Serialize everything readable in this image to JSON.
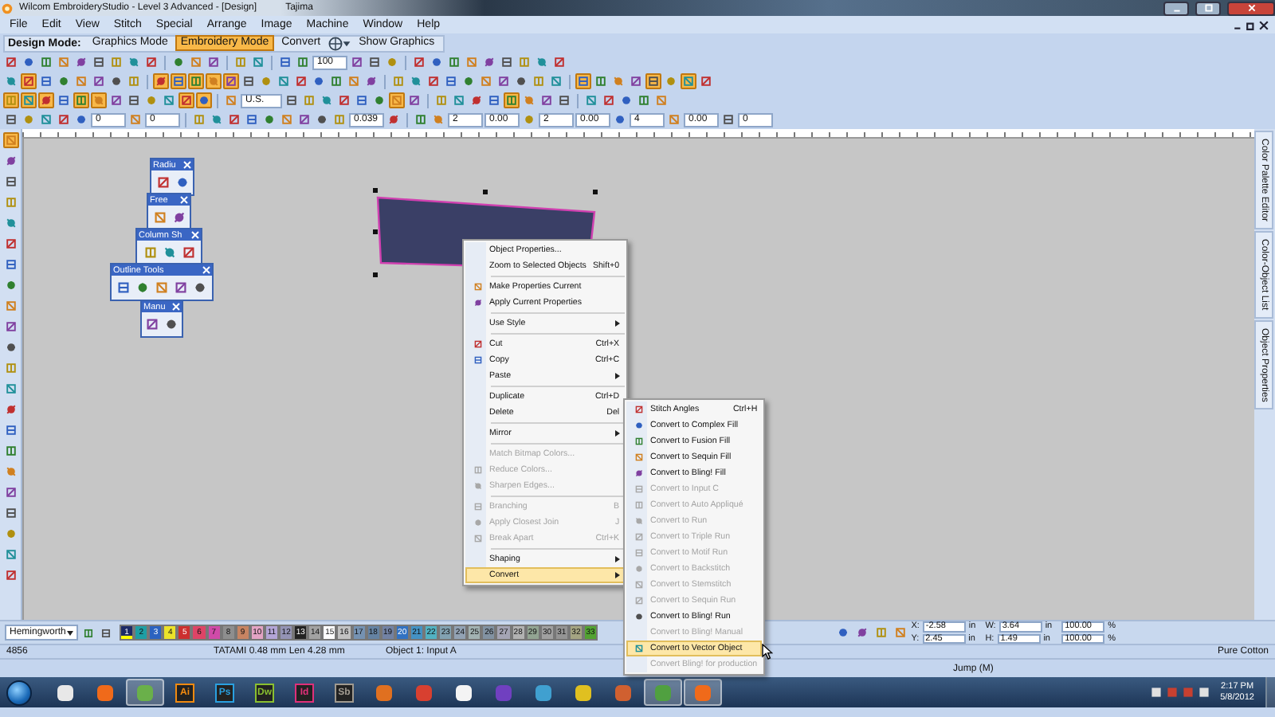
{
  "window": {
    "title": "Wilcom EmbroideryStudio - Level 3 Advanced - [Design]",
    "machine": "Tajima"
  },
  "menu_bar": [
    "File",
    "Edit",
    "View",
    "Stitch",
    "Special",
    "Arrange",
    "Image",
    "Machine",
    "Window",
    "Help"
  ],
  "mode_bar": {
    "label": "Design Mode:",
    "modes": [
      {
        "label": "Graphics Mode",
        "selected": false
      },
      {
        "label": "Embroidery Mode",
        "selected": true
      }
    ],
    "convert": "Convert",
    "show_graphics": "Show Graphics"
  },
  "toolbars": [
    {
      "items": [
        {
          "kind": "icon",
          "pressed": false
        },
        {
          "kind": "icon",
          "pressed": false
        },
        {
          "kind": "icon",
          "pressed": false
        },
        {
          "kind": "icon",
          "pressed": false
        },
        {
          "kind": "icon",
          "pressed": false
        },
        {
          "kind": "icon",
          "pressed": false
        },
        {
          "kind": "icon",
          "pressed": false
        },
        {
          "kind": "icon",
          "pressed": false
        },
        {
          "kind": "icon",
          "pressed": false
        },
        {
          "kind": "sep"
        },
        {
          "kind": "icon",
          "pressed": false
        },
        {
          "kind": "icon",
          "pressed": false
        },
        {
          "kind": "icon",
          "pressed": false
        },
        {
          "kind": "sep"
        },
        {
          "kind": "icon",
          "pressed": false
        },
        {
          "kind": "icon",
          "pressed": false
        },
        {
          "kind": "sep"
        },
        {
          "kind": "icon",
          "pressed": false
        },
        {
          "kind": "icon",
          "pressed": false
        },
        {
          "kind": "field",
          "value": "100"
        },
        {
          "kind": "icon",
          "pressed": false
        },
        {
          "kind": "icon",
          "pressed": false
        },
        {
          "kind": "icon",
          "pressed": false
        },
        {
          "kind": "sep"
        },
        {
          "kind": "icon",
          "pressed": false
        },
        {
          "kind": "icon",
          "pressed": false
        },
        {
          "kind": "icon",
          "pressed": false
        },
        {
          "kind": "icon",
          "pressed": false
        },
        {
          "kind": "icon",
          "pressed": false
        },
        {
          "kind": "icon",
          "pressed": false
        },
        {
          "kind": "icon",
          "pressed": false
        },
        {
          "kind": "icon",
          "pressed": false
        },
        {
          "kind": "icon",
          "pressed": false
        }
      ]
    },
    {
      "items": [
        {
          "kind": "icon",
          "pressed": false
        },
        {
          "kind": "icon",
          "pressed": true
        },
        {
          "kind": "icon",
          "pressed": false
        },
        {
          "kind": "icon",
          "pressed": false
        },
        {
          "kind": "icon",
          "pressed": false
        },
        {
          "kind": "icon",
          "pressed": false
        },
        {
          "kind": "icon",
          "pressed": false
        },
        {
          "kind": "icon",
          "pressed": false
        },
        {
          "kind": "sep"
        },
        {
          "kind": "icon",
          "pressed": true
        },
        {
          "kind": "icon",
          "pressed": true
        },
        {
          "kind": "icon",
          "pressed": true
        },
        {
          "kind": "icon",
          "pressed": true
        },
        {
          "kind": "icon",
          "pressed": true
        },
        {
          "kind": "icon",
          "pressed": false
        },
        {
          "kind": "icon",
          "pressed": false
        },
        {
          "kind": "icon",
          "pressed": false
        },
        {
          "kind": "icon",
          "pressed": false
        },
        {
          "kind": "icon",
          "pressed": false
        },
        {
          "kind": "icon",
          "pressed": false
        },
        {
          "kind": "icon",
          "pressed": false
        },
        {
          "kind": "icon",
          "pressed": false
        },
        {
          "kind": "sep"
        },
        {
          "kind": "icon",
          "pressed": false
        },
        {
          "kind": "icon",
          "pressed": false
        },
        {
          "kind": "icon",
          "pressed": false
        },
        {
          "kind": "icon",
          "pressed": false
        },
        {
          "kind": "icon",
          "pressed": false
        },
        {
          "kind": "icon",
          "pressed": false
        },
        {
          "kind": "icon",
          "pressed": false
        },
        {
          "kind": "icon",
          "pressed": false
        },
        {
          "kind": "icon",
          "pressed": false
        },
        {
          "kind": "icon",
          "pressed": false
        },
        {
          "kind": "sep"
        },
        {
          "kind": "icon",
          "pressed": true
        },
        {
          "kind": "icon",
          "pressed": false
        },
        {
          "kind": "icon",
          "pressed": false
        },
        {
          "kind": "icon",
          "pressed": false
        },
        {
          "kind": "icon",
          "pressed": true
        },
        {
          "kind": "icon",
          "pressed": false
        },
        {
          "kind": "icon",
          "pressed": true
        },
        {
          "kind": "icon",
          "pressed": false
        }
      ]
    },
    {
      "items": [
        {
          "kind": "icon",
          "pressed": true
        },
        {
          "kind": "icon",
          "pressed": true
        },
        {
          "kind": "icon",
          "pressed": true
        },
        {
          "kind": "icon",
          "pressed": false
        },
        {
          "kind": "icon",
          "pressed": true
        },
        {
          "kind": "icon",
          "pressed": true
        },
        {
          "kind": "icon",
          "pressed": false
        },
        {
          "kind": "icon",
          "pressed": false
        },
        {
          "kind": "icon",
          "pressed": false
        },
        {
          "kind": "icon",
          "pressed": false
        },
        {
          "kind": "icon",
          "pressed": true
        },
        {
          "kind": "icon",
          "pressed": true
        },
        {
          "kind": "sep"
        },
        {
          "kind": "icon",
          "pressed": false
        },
        {
          "kind": "dropdown",
          "value": "U.S."
        },
        {
          "kind": "icon",
          "pressed": false
        },
        {
          "kind": "icon",
          "pressed": false
        },
        {
          "kind": "icon",
          "pressed": false
        },
        {
          "kind": "icon",
          "pressed": false
        },
        {
          "kind": "icon",
          "pressed": false
        },
        {
          "kind": "icon",
          "pressed": false
        },
        {
          "kind": "icon",
          "pressed": true
        },
        {
          "kind": "icon",
          "pressed": false
        },
        {
          "kind": "sep"
        },
        {
          "kind": "icon",
          "pressed": false
        },
        {
          "kind": "icon",
          "pressed": false
        },
        {
          "kind": "icon",
          "pressed": false
        },
        {
          "kind": "icon",
          "pressed": false
        },
        {
          "kind": "icon",
          "pressed": true
        },
        {
          "kind": "icon",
          "pressed": false
        },
        {
          "kind": "icon",
          "pressed": false
        },
        {
          "kind": "icon",
          "pressed": false
        },
        {
          "kind": "sep"
        },
        {
          "kind": "icon",
          "pressed": false
        },
        {
          "kind": "icon",
          "pressed": false
        },
        {
          "kind": "icon",
          "pressed": false
        },
        {
          "kind": "icon",
          "pressed": false
        },
        {
          "kind": "icon",
          "pressed": false
        }
      ]
    },
    {
      "items": [
        {
          "kind": "icon",
          "pressed": false
        },
        {
          "kind": "icon",
          "pressed": false
        },
        {
          "kind": "icon",
          "pressed": false
        },
        {
          "kind": "icon",
          "pressed": false
        },
        {
          "kind": "icon",
          "pressed": false
        },
        {
          "kind": "field",
          "value": "0"
        },
        {
          "kind": "icon",
          "pressed": false
        },
        {
          "kind": "field",
          "value": "0"
        },
        {
          "kind": "sep"
        },
        {
          "kind": "icon",
          "pressed": false
        },
        {
          "kind": "icon",
          "pressed": false
        },
        {
          "kind": "icon",
          "pressed": false
        },
        {
          "kind": "icon",
          "pressed": false
        },
        {
          "kind": "icon",
          "pressed": false
        },
        {
          "kind": "icon",
          "pressed": false
        },
        {
          "kind": "icon",
          "pressed": false
        },
        {
          "kind": "icon",
          "pressed": false
        },
        {
          "kind": "icon",
          "pressed": false
        },
        {
          "kind": "field",
          "value": "0.039"
        },
        {
          "kind": "icon",
          "pressed": false
        },
        {
          "kind": "sep"
        },
        {
          "kind": "icon",
          "pressed": false
        },
        {
          "kind": "icon",
          "pressed": false
        },
        {
          "kind": "field",
          "value": "2"
        },
        {
          "kind": "field",
          "value": "0.00"
        },
        {
          "kind": "icon",
          "pressed": false
        },
        {
          "kind": "field",
          "value": "2"
        },
        {
          "kind": "field",
          "value": "0.00"
        },
        {
          "kind": "icon",
          "pressed": false
        },
        {
          "kind": "field",
          "value": "4"
        },
        {
          "kind": "icon",
          "pressed": false
        },
        {
          "kind": "field",
          "value": "0.00"
        },
        {
          "kind": "icon",
          "pressed": false
        },
        {
          "kind": "field",
          "value": "0"
        }
      ]
    }
  ],
  "toolbox": [
    {
      "pressed": true
    },
    {
      "pressed": false
    },
    {
      "pressed": false
    },
    {
      "pressed": false
    },
    {
      "pressed": false
    },
    {
      "pressed": false
    },
    {
      "pressed": false
    },
    {
      "pressed": false
    },
    {
      "pressed": false
    },
    {
      "pressed": false
    },
    {
      "pressed": false
    },
    {
      "pressed": false
    },
    {
      "pressed": false
    },
    {
      "pressed": false
    },
    {
      "pressed": false
    },
    {
      "pressed": false
    },
    {
      "pressed": false
    },
    {
      "pressed": false
    },
    {
      "pressed": false
    },
    {
      "pressed": false
    },
    {
      "pressed": false
    },
    {
      "pressed": false
    }
  ],
  "palettes": [
    {
      "title": "Radiu",
      "buttons": [
        {
          "pressed": false
        },
        {
          "pressed": false
        }
      ]
    },
    {
      "title": "Free",
      "buttons": [
        {
          "pressed": false
        },
        {
          "pressed": false
        }
      ]
    },
    {
      "title": "Column Sh",
      "buttons": [
        {
          "pressed": false
        },
        {
          "pressed": false
        },
        {
          "pressed": false
        }
      ]
    },
    {
      "title": "Outline Tools",
      "buttons": [
        {
          "pressed": false
        },
        {
          "pressed": false
        },
        {
          "pressed": false
        },
        {
          "pressed": false
        },
        {
          "pressed": false
        }
      ]
    },
    {
      "title": "Manu",
      "buttons": [
        {
          "pressed": false
        },
        {
          "pressed": false
        }
      ]
    }
  ],
  "side_tabs": [
    "Color Palette Editor",
    "Color-Object List",
    "Object Properties"
  ],
  "context_menu": {
    "items": [
      {
        "kind": "item",
        "label": "Object Properties...",
        "disabled": false,
        "selected": false,
        "icon": false
      },
      {
        "kind": "item",
        "label": "Zoom to Selected Objects",
        "shortcut": "Shift+0",
        "disabled": false,
        "selected": false,
        "icon": false
      },
      {
        "kind": "separator"
      },
      {
        "kind": "item",
        "label": "Make Properties Current",
        "disabled": false,
        "selected": false,
        "icon": true
      },
      {
        "kind": "item",
        "label": "Apply Current Properties",
        "disabled": false,
        "selected": false,
        "icon": true
      },
      {
        "kind": "separator"
      },
      {
        "kind": "item",
        "label": "Use Style",
        "submenu": true,
        "disabled": false,
        "selected": false,
        "icon": false
      },
      {
        "kind": "separator"
      },
      {
        "kind": "item",
        "label": "Cut",
        "shortcut": "Ctrl+X",
        "disabled": false,
        "selected": false,
        "icon": true
      },
      {
        "kind": "item",
        "label": "Copy",
        "shortcut": "Ctrl+C",
        "disabled": false,
        "selected": false,
        "icon": true
      },
      {
        "kind": "item",
        "label": "Paste",
        "submenu": true,
        "disabled": false,
        "selected": false,
        "icon": false
      },
      {
        "kind": "separator"
      },
      {
        "kind": "item",
        "label": "Duplicate",
        "shortcut": "Ctrl+D",
        "disabled": false,
        "selected": false,
        "icon": false
      },
      {
        "kind": "item",
        "label": "Delete",
        "shortcut": "Del",
        "disabled": false,
        "selected": false,
        "icon": false
      },
      {
        "kind": "separator"
      },
      {
        "kind": "item",
        "label": "Mirror",
        "submenu": true,
        "disabled": false,
        "selected": false,
        "icon": false
      },
      {
        "kind": "separator"
      },
      {
        "kind": "item",
        "label": "Match Bitmap Colors...",
        "disabled": true,
        "selected": false,
        "icon": false
      },
      {
        "kind": "item",
        "label": "Reduce Colors...",
        "disabled": true,
        "selected": false,
        "icon": true
      },
      {
        "kind": "item",
        "label": "Sharpen Edges...",
        "disabled": true,
        "selected": false,
        "icon": true
      },
      {
        "kind": "separator"
      },
      {
        "kind": "item",
        "label": "Branching",
        "shortcut": "B",
        "disabled": true,
        "selected": false,
        "icon": true
      },
      {
        "kind": "item",
        "label": "Apply Closest Join",
        "shortcut": "J",
        "disabled": true,
        "selected": false,
        "icon": true
      },
      {
        "kind": "item",
        "label": "Break Apart",
        "shortcut": "Ctrl+K",
        "disabled": true,
        "selected": false,
        "icon": true
      },
      {
        "kind": "separator"
      },
      {
        "kind": "item",
        "label": "Shaping",
        "submenu": true,
        "disabled": false,
        "selected": false,
        "icon": false
      },
      {
        "kind": "item",
        "label": "Convert",
        "submenu": true,
        "disabled": false,
        "selected": true,
        "icon": false
      }
    ]
  },
  "submenu": {
    "items": [
      {
        "kind": "item",
        "label": "Stitch Angles",
        "shortcut": "Ctrl+H",
        "disabled": false,
        "selected": false,
        "icon": true
      },
      {
        "kind": "item",
        "label": "Convert to Complex Fill",
        "disabled": false,
        "selected": false,
        "icon": true
      },
      {
        "kind": "item",
        "label": "Convert to Fusion Fill",
        "disabled": false,
        "selected": false,
        "icon": true
      },
      {
        "kind": "item",
        "label": "Convert to Sequin Fill",
        "disabled": false,
        "selected": false,
        "icon": true
      },
      {
        "kind": "item",
        "label": "Convert to Bling! Fill",
        "disabled": false,
        "selected": false,
        "icon": true
      },
      {
        "kind": "item",
        "label": "Convert to Input C",
        "disabled": true,
        "selected": false,
        "icon": true
      },
      {
        "kind": "item",
        "label": "Convert to Auto Appliqué",
        "disabled": true,
        "selected": false,
        "icon": true
      },
      {
        "kind": "item",
        "label": "Convert to Run",
        "disabled": true,
        "selected": false,
        "icon": true
      },
      {
        "kind": "item",
        "label": "Convert to Triple Run",
        "disabled": true,
        "selected": false,
        "icon": true
      },
      {
        "kind": "item",
        "label": "Convert to Motif Run",
        "disabled": true,
        "selected": false,
        "icon": true
      },
      {
        "kind": "item",
        "label": "Convert to Backstitch",
        "disabled": true,
        "selected": false,
        "icon": true
      },
      {
        "kind": "item",
        "label": "Convert to Stemstitch",
        "disabled": true,
        "selected": false,
        "icon": true
      },
      {
        "kind": "item",
        "label": "Convert to Sequin Run",
        "disabled": true,
        "selected": false,
        "icon": true
      },
      {
        "kind": "item",
        "label": "Convert to Bling! Run",
        "disabled": false,
        "selected": false,
        "icon": true
      },
      {
        "kind": "item",
        "label": "Convert to Bling! Manual",
        "disabled": true,
        "selected": false,
        "icon": false
      },
      {
        "kind": "item",
        "label": "Convert to Vector Object",
        "disabled": false,
        "selected": true,
        "icon": true
      },
      {
        "kind": "item",
        "label": "Convert Bling! for production",
        "disabled": true,
        "selected": false,
        "icon": false
      }
    ]
  },
  "color_bar": {
    "palette": "Hemingworth",
    "swatches": [
      {
        "label": "1",
        "color": "#1c2a66",
        "selected": true
      },
      {
        "label": "2",
        "color": "#1e9ea4",
        "selected": false
      },
      {
        "label": "3",
        "color": "#2b62c0",
        "selected": false
      },
      {
        "label": "4",
        "color": "#ece22a",
        "selected": false
      },
      {
        "label": "5",
        "color": "#cc2f2f",
        "selected": false
      },
      {
        "label": "6",
        "color": "#de4466",
        "selected": false
      },
      {
        "label": "7",
        "color": "#d04aa8",
        "selected": false
      },
      {
        "label": "8",
        "color": "#8e8e8e",
        "selected": false
      },
      {
        "label": "9",
        "color": "#c78462",
        "selected": false
      },
      {
        "label": "10",
        "color": "#e3a3c4",
        "selected": false
      },
      {
        "label": "11",
        "color": "#b3a5d6",
        "selected": false
      },
      {
        "label": "12",
        "color": "#9393b4",
        "selected": false
      },
      {
        "label": "13",
        "color": "#222222",
        "selected": false
      },
      {
        "label": "14",
        "color": "#a2a2a2",
        "selected": false
      },
      {
        "label": "15",
        "color": "#ffffff",
        "selected": false
      },
      {
        "label": "16",
        "color": "#c2c2c2",
        "selected": false
      },
      {
        "label": "17",
        "color": "#7592b2",
        "selected": false
      },
      {
        "label": "18",
        "color": "#6482a2",
        "selected": false
      },
      {
        "label": "19",
        "color": "#7282a4",
        "selected": false
      },
      {
        "label": "20",
        "color": "#3272c2",
        "selected": false
      },
      {
        "label": "21",
        "color": "#4492c4",
        "selected": false
      },
      {
        "label": "22",
        "color": "#52b2c2",
        "selected": false
      },
      {
        "label": "23",
        "color": "#82a2b2",
        "selected": false
      },
      {
        "label": "24",
        "color": "#92a2b4",
        "selected": false
      },
      {
        "label": "25",
        "color": "#a2b2b2",
        "selected": false
      },
      {
        "label": "26",
        "color": "#8292a2",
        "selected": false
      },
      {
        "label": "27",
        "color": "#a4a4b4",
        "selected": false
      },
      {
        "label": "28",
        "color": "#b2b2b2",
        "selected": false
      },
      {
        "label": "29",
        "color": "#92a492",
        "selected": false
      },
      {
        "label": "30",
        "color": "#a0a0a0",
        "selected": false
      },
      {
        "label": "31",
        "color": "#949494",
        "selected": false
      },
      {
        "label": "32",
        "color": "#a4a482",
        "selected": false
      },
      {
        "label": "33",
        "color": "#52a232",
        "selected": false
      }
    ],
    "coordinates": [
      {
        "label": "X:",
        "value": "-2.58",
        "unit": "in"
      },
      {
        "label": "W:",
        "value": "3.64",
        "unit": "in"
      },
      {
        "label": "Y:",
        "value": "2.45",
        "unit": "in"
      },
      {
        "label": "H:",
        "value": "1.49",
        "unit": "in"
      }
    ],
    "scale": [
      {
        "value": "100.00",
        "unit": "%"
      },
      {
        "value": "100.00",
        "unit": "%"
      }
    ]
  },
  "status_bar": {
    "stitches": "4856",
    "stitch_info": "TATAMI 0.48 mm Len 4.28 mm",
    "object": "Object 1: Input A",
    "fabric": "Pure Cotton",
    "mode": "Jump (M)"
  },
  "taskbar": {
    "apps": [
      {
        "kind": "glyph",
        "color": "#e8e8e8",
        "active": false
      },
      {
        "kind": "glyph",
        "color": "#f06a1a",
        "active": false
      },
      {
        "kind": "glyph",
        "color": "#6ab04a",
        "active": true
      },
      {
        "kind": "badge",
        "label": "Ai",
        "color": "#f08a10",
        "active": false
      },
      {
        "kind": "badge",
        "label": "Ps",
        "color": "#2aa0e0",
        "active": false
      },
      {
        "kind": "badge",
        "label": "Dw",
        "color": "#8ac030",
        "active": false
      },
      {
        "kind": "badge",
        "label": "Id",
        "color": "#e0307a",
        "active": false
      },
      {
        "kind": "badge",
        "label": "Sb",
        "color": "#a09a90",
        "active": false
      },
      {
        "kind": "glyph",
        "color": "#e07020",
        "active": false
      },
      {
        "kind": "glyph",
        "color": "#d84030",
        "active": false
      },
      {
        "kind": "glyph",
        "color": "#f4f4f4",
        "active": false
      },
      {
        "kind": "glyph",
        "color": "#7040c0",
        "active": false
      },
      {
        "kind": "glyph",
        "color": "#40a0d0",
        "active": false
      },
      {
        "kind": "glyph",
        "color": "#e0c020",
        "active": false
      },
      {
        "kind": "glyph",
        "color": "#d06030",
        "active": false
      },
      {
        "kind": "glyph",
        "color": "#50a040",
        "active": true
      },
      {
        "kind": "glyph",
        "color": "#f06a1a",
        "active": true
      }
    ],
    "time": "2:17 PM",
    "date": "5/8/2012"
  }
}
